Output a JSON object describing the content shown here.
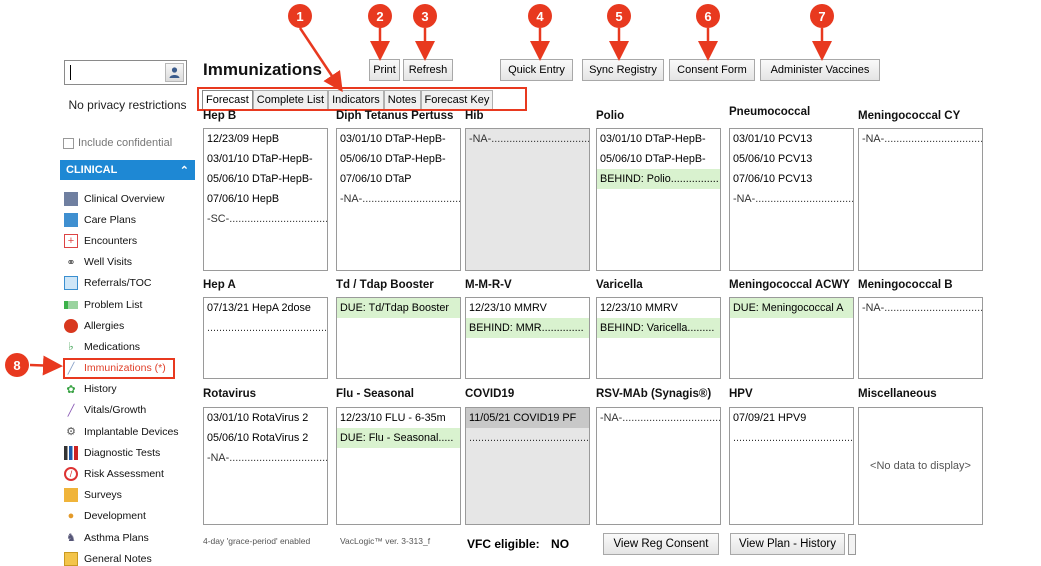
{
  "search": {
    "value": ""
  },
  "sidebar": {
    "privacy_text": "No privacy restrictions",
    "include_confidential": "Include confidential",
    "section_label": "CLINICAL",
    "items": [
      {
        "label": "Clinical Overview",
        "icon": "overview-icon"
      },
      {
        "label": "Care Plans",
        "icon": "care-plans-icon"
      },
      {
        "label": "Encounters",
        "icon": "encounters-icon"
      },
      {
        "label": "Well Visits",
        "icon": "stethoscope-icon"
      },
      {
        "label": "Referrals/TOC",
        "icon": "referrals-icon"
      },
      {
        "label": "Problem List",
        "icon": "problem-list-icon"
      },
      {
        "label": "Allergies",
        "icon": "allergies-icon"
      },
      {
        "label": "Medications",
        "icon": "medications-icon"
      },
      {
        "label": "Immunizations (*)",
        "icon": "syringe-icon"
      },
      {
        "label": "History",
        "icon": "history-icon"
      },
      {
        "label": "Vitals/Growth",
        "icon": "vitals-icon"
      },
      {
        "label": "Implantable Devices",
        "icon": "device-icon"
      },
      {
        "label": "Diagnostic Tests",
        "icon": "diagnostic-icon"
      },
      {
        "label": "Risk Assessment",
        "icon": "risk-icon"
      },
      {
        "label": "Surveys",
        "icon": "surveys-icon"
      },
      {
        "label": "Development",
        "icon": "development-icon"
      },
      {
        "label": "Asthma Plans",
        "icon": "asthma-icon"
      },
      {
        "label": "General Notes",
        "icon": "notes-icon"
      }
    ]
  },
  "header": {
    "title": "Immunizations",
    "buttons": {
      "print": "Print",
      "refresh": "Refresh",
      "quick_entry": "Quick Entry",
      "sync_registry": "Sync Registry",
      "consent_form": "Consent Form",
      "administer_vaccines": "Administer Vaccines"
    }
  },
  "callouts": [
    "1",
    "2",
    "3",
    "4",
    "5",
    "6",
    "7",
    "8"
  ],
  "tabs": [
    "Forecast",
    "Complete List",
    "Indicators",
    "Notes",
    "Forecast Key"
  ],
  "vaccines": [
    {
      "label": "Hep B",
      "rows": [
        {
          "text": "12/23/09  HepB",
          "type": "normal"
        },
        {
          "text": "03/01/10  DTaP-HepB-",
          "type": "normal"
        },
        {
          "text": "05/06/10  DTaP-HepB-",
          "type": "normal"
        },
        {
          "text": "07/06/10  HepB",
          "type": "normal"
        },
        {
          "text": "-SC-.................................",
          "type": "dots"
        }
      ]
    },
    {
      "label": "Diph Tetanus Pertuss",
      "rows": [
        {
          "text": "03/01/10  DTaP-HepB-",
          "type": "normal"
        },
        {
          "text": "05/06/10  DTaP-HepB-",
          "type": "normal"
        },
        {
          "text": "07/06/10  DTaP",
          "type": "normal"
        },
        {
          "text": "-NA-.................................",
          "type": "dots"
        }
      ]
    },
    {
      "label": "Hib",
      "gray": true,
      "rows": [
        {
          "text": "-NA-.................................",
          "type": "dots"
        }
      ]
    },
    {
      "label": "Polio",
      "rows": [
        {
          "text": "03/01/10  DTaP-HepB-",
          "type": "normal"
        },
        {
          "text": "05/06/10  DTaP-HepB-",
          "type": "normal"
        },
        {
          "text": "BEHIND: Polio................",
          "type": "due"
        }
      ]
    },
    {
      "label": "Pneumococcal",
      "rows": [
        {
          "text": "03/01/10  PCV13",
          "type": "normal"
        },
        {
          "text": "05/06/10  PCV13",
          "type": "normal"
        },
        {
          "text": "07/06/10  PCV13",
          "type": "normal"
        },
        {
          "text": "-NA-.................................",
          "type": "dots"
        }
      ]
    },
    {
      "label": "Meningococcal CY",
      "rows": [
        {
          "text": "-NA-.................................",
          "type": "dots"
        }
      ]
    },
    {
      "label": "Hep A",
      "rows": [
        {
          "text": "07/13/21  HepA 2dose",
          "type": "normal"
        },
        {
          "text": ".........................................",
          "type": "dots"
        }
      ]
    },
    {
      "label": "Td / Tdap Booster",
      "rows": [
        {
          "text": "DUE: Td/Tdap Booster",
          "type": "due"
        }
      ]
    },
    {
      "label": "M-M-R-V",
      "rows": [
        {
          "text": "12/23/10  MMRV",
          "type": "normal"
        },
        {
          "text": "BEHIND: MMR..............",
          "type": "due"
        }
      ]
    },
    {
      "label": "Varicella",
      "rows": [
        {
          "text": "12/23/10  MMRV",
          "type": "normal"
        },
        {
          "text": "BEHIND: Varicella.........",
          "type": "due"
        }
      ]
    },
    {
      "label": "Meningococcal ACWY",
      "rows": [
        {
          "text": "DUE: Meningococcal A",
          "type": "due"
        }
      ]
    },
    {
      "label": "Meningococcal B",
      "rows": [
        {
          "text": "-NA-.................................",
          "type": "dots"
        }
      ]
    },
    {
      "label": "Rotavirus",
      "rows": [
        {
          "text": "03/01/10  RotaVirus 2",
          "type": "normal"
        },
        {
          "text": "05/06/10  RotaVirus 2",
          "type": "normal"
        },
        {
          "text": "-NA-.................................",
          "type": "dots"
        }
      ]
    },
    {
      "label": "Flu - Seasonal",
      "rows": [
        {
          "text": "12/23/10  FLU - 6-35m",
          "type": "normal"
        },
        {
          "text": "DUE: Flu - Seasonal.....",
          "type": "due"
        }
      ]
    },
    {
      "label": "COVID19",
      "gray": true,
      "rows": [
        {
          "text": "11/05/21  COVID19 PF",
          "type": "gray"
        },
        {
          "text": ".........................................",
          "type": "dots"
        }
      ]
    },
    {
      "label": "RSV-MAb (Synagis®)",
      "rows": [
        {
          "text": "-NA-.................................",
          "type": "dots"
        }
      ]
    },
    {
      "label": "HPV",
      "rows": [
        {
          "text": "07/09/21  HPV9",
          "type": "normal"
        },
        {
          "text": ".........................................",
          "type": "dots"
        }
      ]
    },
    {
      "label": "Miscellaneous",
      "rows": [],
      "empty_text": "<No data to display>"
    }
  ],
  "footer": {
    "grace_period": "4-day 'grace-period' enabled",
    "vaclogic": "VacLogic™  ver. 3-313_f",
    "vfc_label": "VFC eligible:",
    "vfc_value": "NO",
    "view_reg_consent": "View Reg Consent",
    "view_plan_history": "View Plan - History"
  },
  "colors": {
    "accent": "#1e88d4",
    "callout": "#e8391f",
    "due_bg": "#d9f2cf"
  }
}
